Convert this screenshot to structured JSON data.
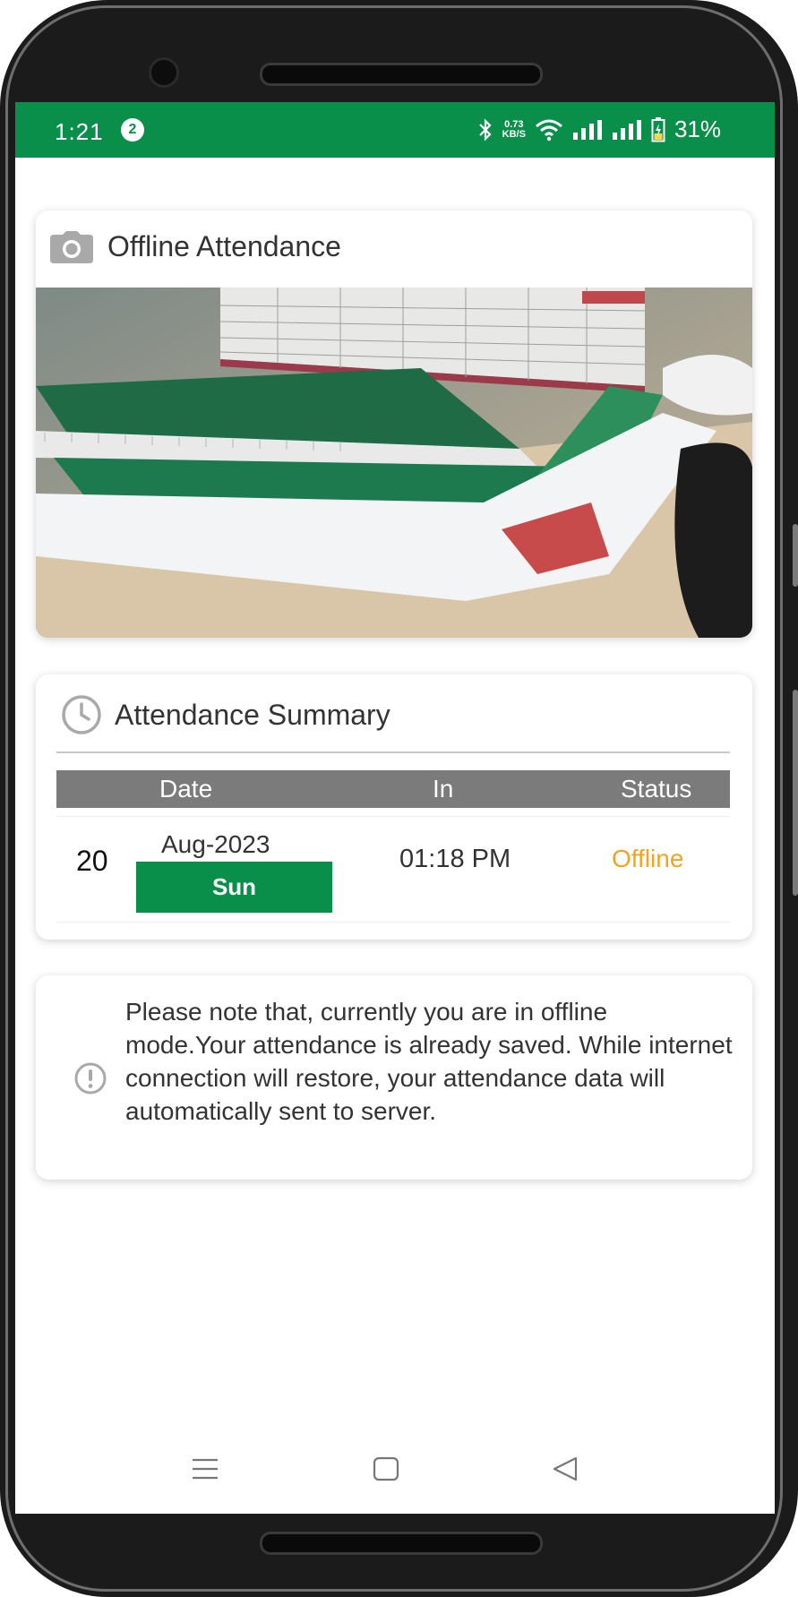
{
  "status_bar": {
    "time": "1:21",
    "notification_count": "2",
    "net_speed_value": "0.73",
    "net_speed_unit": "KB/S",
    "battery": "31%",
    "color": "#0a8f4b"
  },
  "photo_card": {
    "title": "Offline Attendance",
    "icon": "camera-icon"
  },
  "summary_card": {
    "title": "Attendance Summary",
    "icon": "clock-icon",
    "columns": [
      "Date",
      "In",
      "Status"
    ],
    "row": {
      "day": "20",
      "month_year": "Aug-2023",
      "weekday": "Sun",
      "in_time": "01:18 PM",
      "status": "Offline"
    },
    "status_color": "#f5a31f",
    "accent": "#0a8f4b"
  },
  "note_card": {
    "icon": "exclamation-circle-icon",
    "text": "Please note that, currently you are in offline mode.Your attendance is already saved. While internet connection will restore, your attendance data will automatically sent to server."
  },
  "nav_bar": {
    "items": [
      "menu-icon",
      "home-icon",
      "back-icon"
    ]
  }
}
